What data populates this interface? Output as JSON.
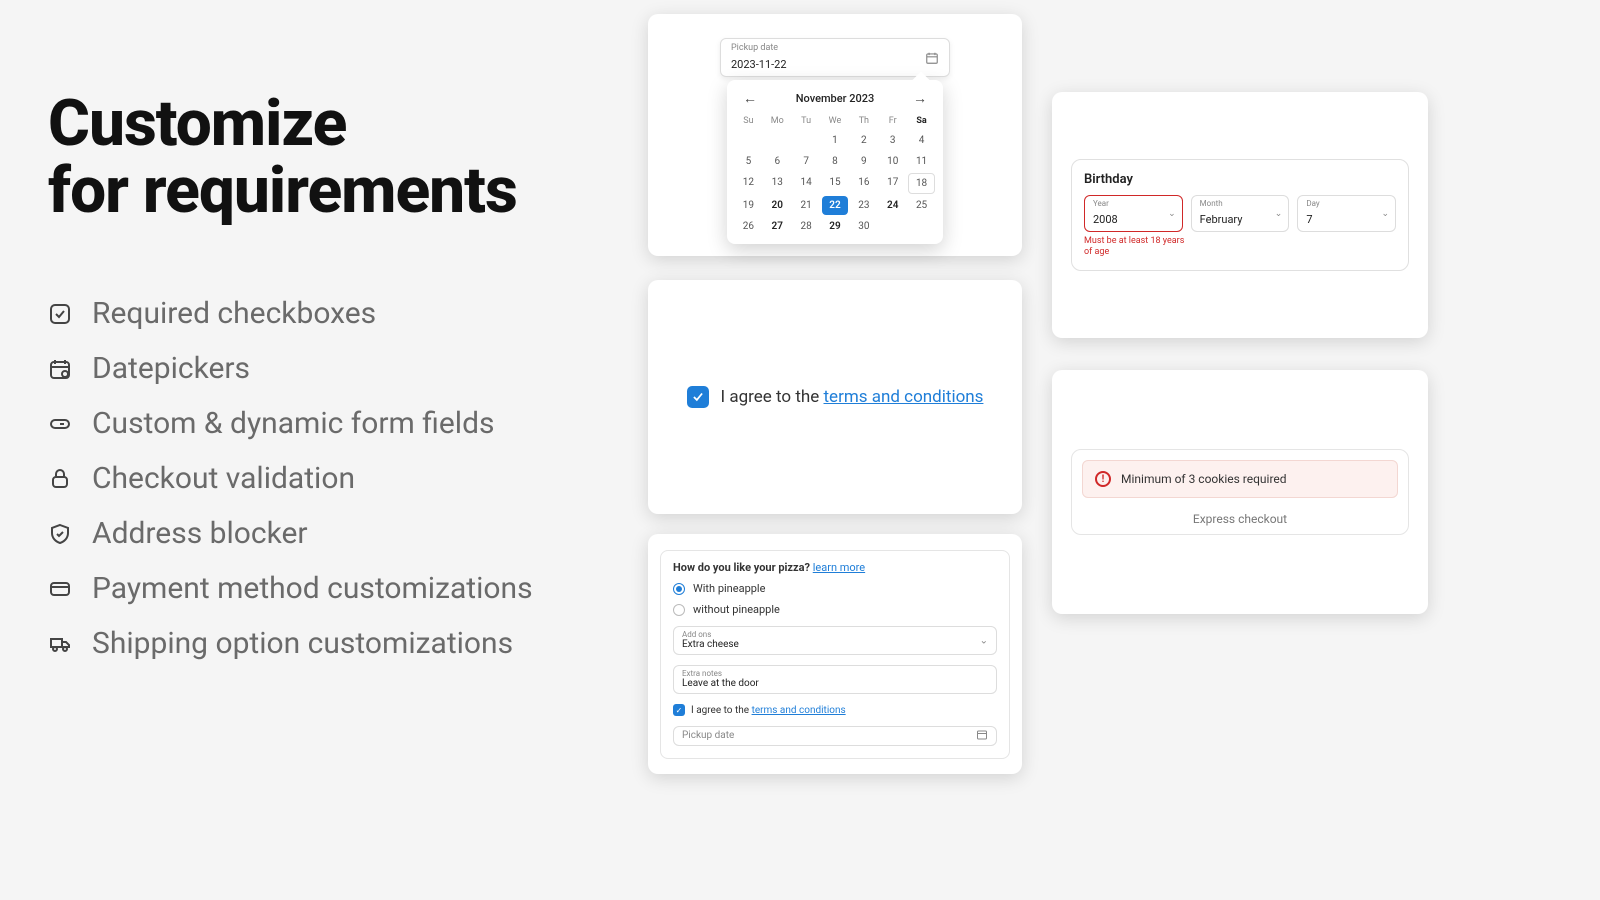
{
  "heading_line1": "Customize",
  "heading_line2": "for requirements",
  "features": [
    "Required checkboxes",
    "Datepickers",
    "Custom & dynamic form fields",
    "Checkout validation",
    "Address blocker",
    "Payment method customizations",
    "Shipping option customizations"
  ],
  "datepicker": {
    "label": "Pickup date",
    "value": "2023-11-22",
    "month_label": "November 2023",
    "days_of_week": [
      "Su",
      "Mo",
      "Tu",
      "We",
      "Th",
      "Fr",
      "Sa"
    ],
    "weeks": [
      [
        null,
        null,
        null,
        1,
        2,
        3,
        4
      ],
      [
        5,
        6,
        7,
        8,
        9,
        10,
        11
      ],
      [
        12,
        13,
        14,
        15,
        16,
        17,
        18
      ],
      [
        19,
        20,
        21,
        22,
        23,
        24,
        25
      ],
      [
        26,
        27,
        28,
        29,
        30,
        null,
        null
      ]
    ],
    "bold_days": [
      20,
      22,
      24,
      27,
      29
    ],
    "selected_day": 22,
    "outlined_day": 18
  },
  "agree": {
    "text_prefix": "I agree to the ",
    "link_text": "terms and conditions"
  },
  "pizza": {
    "question": "How do you like your pizza?",
    "learn_more": "learn more",
    "options": [
      {
        "label": "With pineapple",
        "selected": true
      },
      {
        "label": "without pineapple",
        "selected": false
      }
    ],
    "addons_label": "Add ons",
    "addons_value": "Extra cheese",
    "notes_label": "Extra notes",
    "notes_value": "Leave at the door",
    "agree_prefix": "I agree to the ",
    "agree_link": "terms and conditions",
    "pickup_label": "Pickup date"
  },
  "birthday": {
    "title": "Birthday",
    "year_label": "Year",
    "year_value": "2008",
    "month_label": "Month",
    "month_value": "February",
    "day_label": "Day",
    "day_value": "7",
    "error": "Must be at least 18 years of age"
  },
  "cookies": {
    "warning": "Minimum of 3 cookies required",
    "express": "Express checkout"
  }
}
